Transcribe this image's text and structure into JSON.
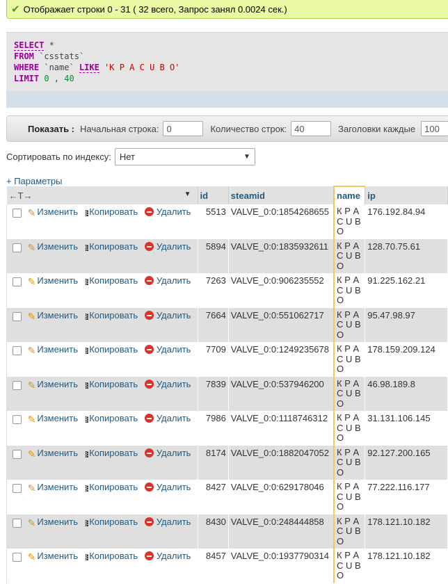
{
  "status": {
    "message": "Отображает строки 0 - 31 ( 32 всего, Запрос занял 0.0024 сек.)",
    "icon": "check-icon"
  },
  "sql": {
    "select_kw": "SELECT",
    "select_rest": " *",
    "from_kw": "FROM",
    "from_rest": " `csstats`",
    "where_kw": "WHERE",
    "where_field": " `name` ",
    "like_kw": "LIKE",
    "where_value": " 'К Р А С U В О'",
    "limit_kw": "LIMIT",
    "limit_a": " 0",
    "limit_sep": " , ",
    "limit_b": "40"
  },
  "navigation": {
    "show_label": "Показать :",
    "start_label": "Начальная строка:",
    "start_value": "0",
    "count_label": "Количество строк:",
    "count_value": "40",
    "headers_label": "Заголовки каждые",
    "headers_value": "100"
  },
  "sort": {
    "label": "Сортировать по индексу:",
    "value": "Нет"
  },
  "params_link": "+ Параметры",
  "table": {
    "arrows": "←T→",
    "columns": [
      "id",
      "steamid",
      "name",
      "ip"
    ],
    "actions": {
      "edit": "Изменить",
      "copy": "Копировать",
      "delete": "Удалить"
    },
    "rows": [
      {
        "id": "5513",
        "steamid": "VALVE_0:0:1854268655",
        "name": "К Р А С U В О",
        "ip": "176.192.84.94"
      },
      {
        "id": "5894",
        "steamid": "VALVE_0:0:1835932611",
        "name": "К Р А С U В О",
        "ip": "128.70.75.61"
      },
      {
        "id": "7263",
        "steamid": "VALVE_0:0:906235552",
        "name": "К Р А С U В О",
        "ip": "91.225.162.21"
      },
      {
        "id": "7664",
        "steamid": "VALVE_0:0:551062717",
        "name": "К Р А С U В О",
        "ip": "95.47.98.97"
      },
      {
        "id": "7709",
        "steamid": "VALVE_0:0:1249235678",
        "name": "К Р А С U В О",
        "ip": "178.159.209.124"
      },
      {
        "id": "7839",
        "steamid": "VALVE_0:0:537946200",
        "name": "К Р А С U В О",
        "ip": "46.98.189.8"
      },
      {
        "id": "7986",
        "steamid": "VALVE_0:0:1118746312",
        "name": "К Р А С U В О",
        "ip": "31.131.106.145"
      },
      {
        "id": "8174",
        "steamid": "VALVE_0:0:1882047052",
        "name": "К Р А С U В О",
        "ip": "92.127.200.165"
      },
      {
        "id": "8427",
        "steamid": "VALVE_0:0:629178046",
        "name": "К Р А С U В О",
        "ip": "77.222.116.177"
      },
      {
        "id": "8430",
        "steamid": "VALVE_0:0:248444858",
        "name": "К Р А С U В О",
        "ip": "178.121.10.182"
      },
      {
        "id": "8457",
        "steamid": "VALVE_0:0:1937790314",
        "name": "К Р А С U В О",
        "ip": "178.121.10.182"
      }
    ]
  }
}
